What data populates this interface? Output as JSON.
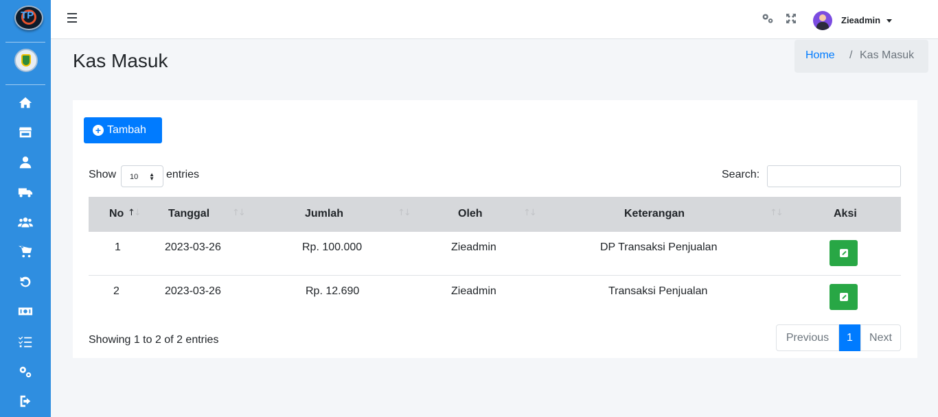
{
  "app": {
    "username": "Zieadmin"
  },
  "sidebar": {
    "brand_text": "TP",
    "items": [
      {
        "icon": "home-icon"
      },
      {
        "icon": "store-icon"
      },
      {
        "icon": "user-icon"
      },
      {
        "icon": "truck-icon"
      },
      {
        "icon": "users-icon"
      },
      {
        "icon": "cart-icon"
      },
      {
        "icon": "undo-icon"
      },
      {
        "icon": "money-icon"
      },
      {
        "icon": "tasks-icon"
      },
      {
        "icon": "gears-icon"
      },
      {
        "icon": "logout-icon"
      }
    ]
  },
  "header": {
    "title": "Kas Masuk",
    "breadcrumb": {
      "home": "Home",
      "separator": "/",
      "current": "Kas Masuk"
    }
  },
  "toolbar": {
    "add_label": "Tambah"
  },
  "table_controls": {
    "show_label": "Show",
    "length_value": "10",
    "entries_label": "entries",
    "search_label": "Search:",
    "search_value": ""
  },
  "table": {
    "headers": [
      "No",
      "Tanggal",
      "Jumlah",
      "Oleh",
      "Keterangan",
      "Aksi"
    ],
    "rows": [
      {
        "no": "1",
        "tanggal": "2023-03-26",
        "jumlah": "Rp. 100.000",
        "oleh": "Zieadmin",
        "keterangan": "DP Transaksi Penjualan"
      },
      {
        "no": "2",
        "tanggal": "2023-03-26",
        "jumlah": "Rp. 12.690",
        "oleh": "Zieadmin",
        "keterangan": "Transaksi Penjualan"
      }
    ]
  },
  "footer": {
    "info": "Showing 1 to 2 of 2 entries",
    "pager": {
      "previous": "Previous",
      "current": "1",
      "next": "Next"
    }
  },
  "colors": {
    "sidebar": "#2f8ee0",
    "primary": "#007bff",
    "success": "#28a745",
    "table_head": "#d6d8db"
  }
}
